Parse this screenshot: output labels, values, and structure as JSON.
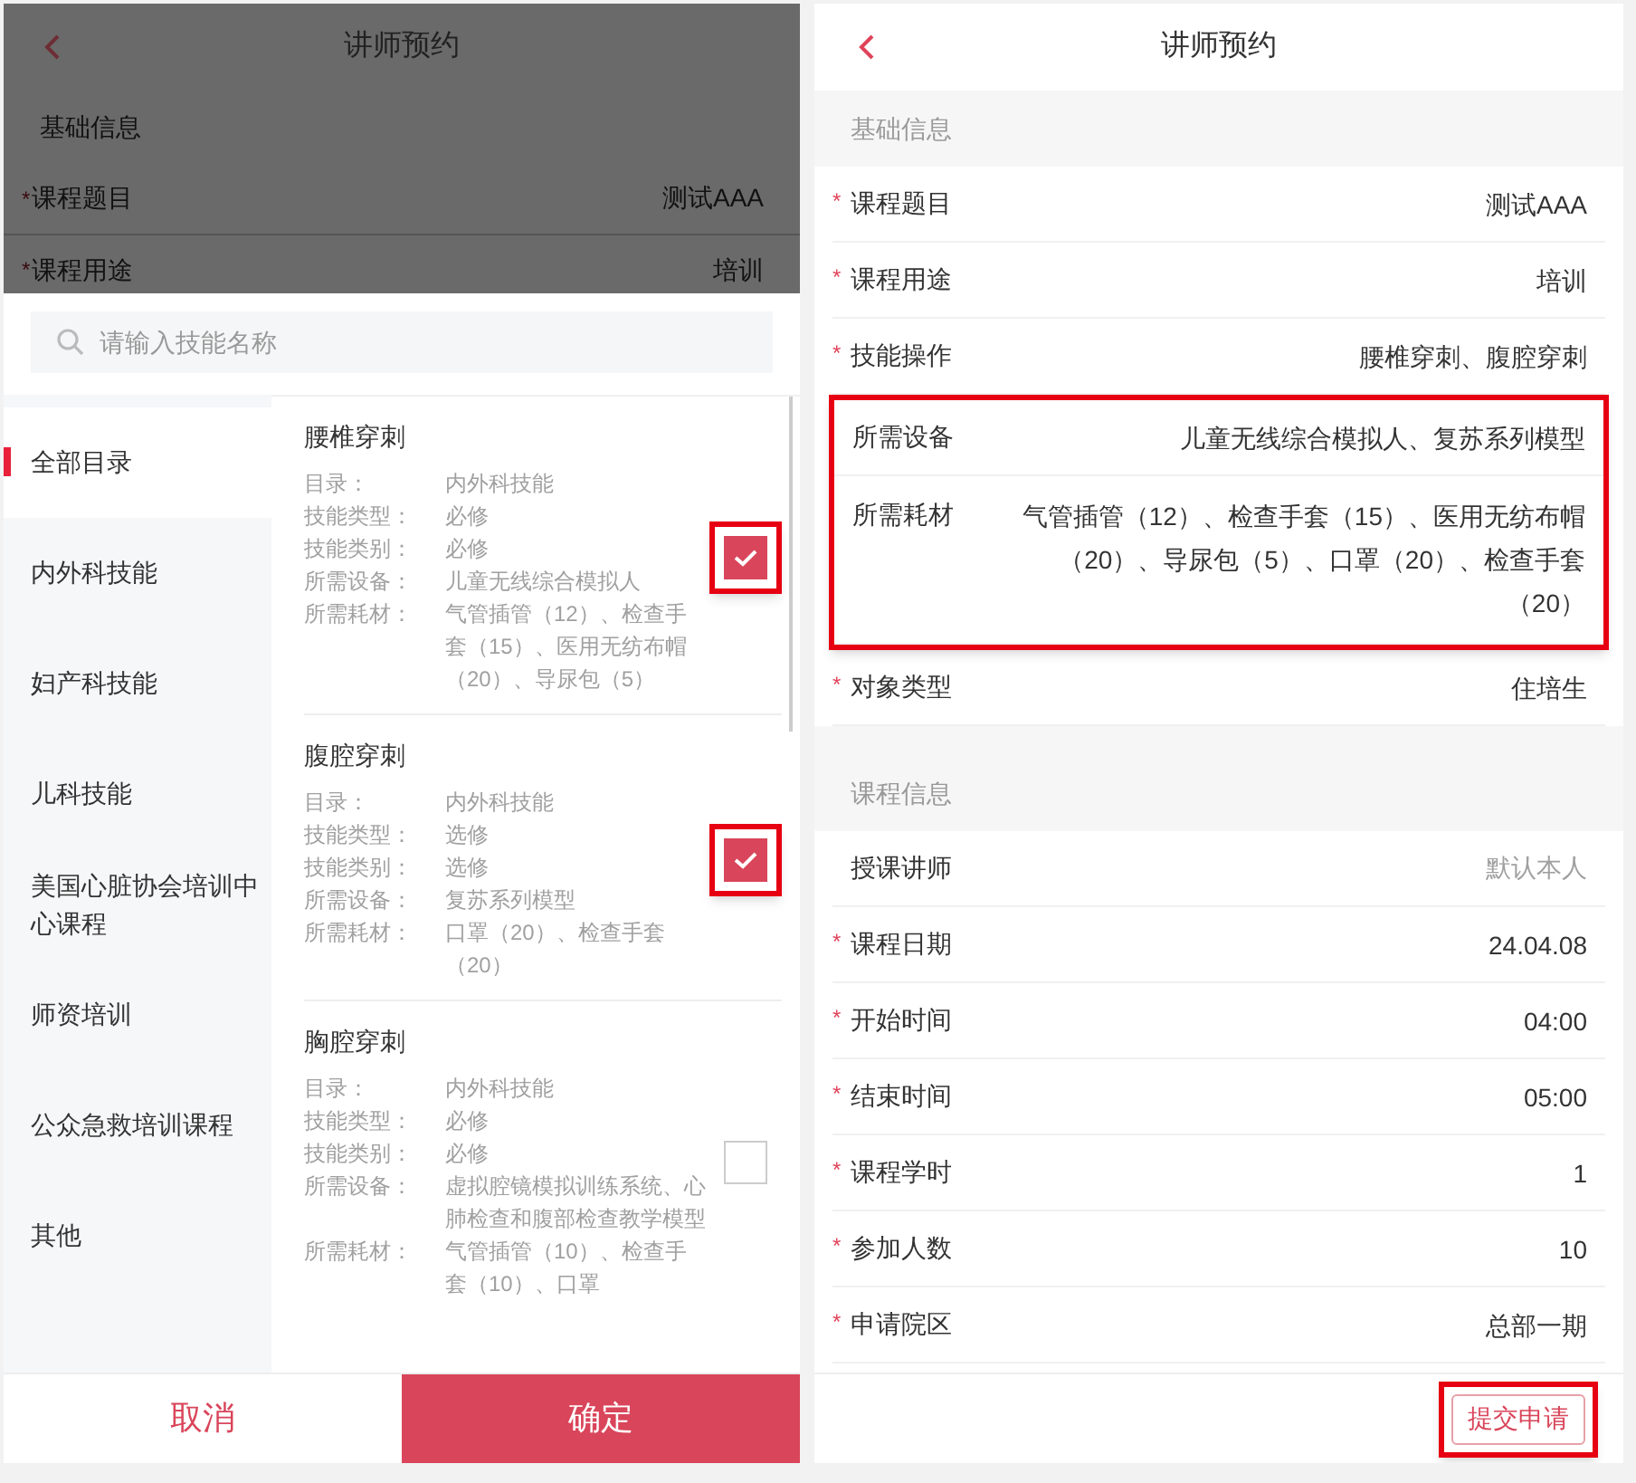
{
  "background_page": {
    "title": "讲师预约",
    "section": "基础信息",
    "rows": [
      {
        "marker": "*",
        "label": "课程题目",
        "value": "测试AAA"
      },
      {
        "marker": "*",
        "label": "课程用途",
        "value": "培训"
      }
    ]
  },
  "picker": {
    "search": {
      "placeholder": "请输入技能名称"
    },
    "categories": [
      {
        "label": "全部目录",
        "selected": true
      },
      {
        "label": "内外科技能",
        "selected": false
      },
      {
        "label": "妇产科技能",
        "selected": false
      },
      {
        "label": "儿科技能",
        "selected": false
      },
      {
        "label": "美国心脏协会培训中心课程",
        "selected": false
      },
      {
        "label": "师资培训",
        "selected": false
      },
      {
        "label": "公众急救培训课程",
        "selected": false
      },
      {
        "label": "其他",
        "selected": false
      }
    ],
    "skills": [
      {
        "name": "腰椎穿刺",
        "checked": true,
        "highlighted": true,
        "details": [
          {
            "label": "目录：",
            "value": "内外科技能"
          },
          {
            "label": "技能类型：",
            "value": "必修"
          },
          {
            "label": "技能类别：",
            "value": "必修"
          },
          {
            "label": "所需设备：",
            "value": "儿童无线综合模拟人"
          },
          {
            "label": "所需耗材：",
            "value": "气管插管（12）、检查手套（15）、医用无纺布帽（20）、导尿包（5）"
          }
        ]
      },
      {
        "name": "腹腔穿刺",
        "checked": true,
        "highlighted": true,
        "details": [
          {
            "label": "目录：",
            "value": "内外科技能"
          },
          {
            "label": "技能类型：",
            "value": "选修"
          },
          {
            "label": "技能类别：",
            "value": "选修"
          },
          {
            "label": "所需设备：",
            "value": "复苏系列模型"
          },
          {
            "label": "所需耗材：",
            "value": "口罩（20）、检查手套（20）"
          }
        ]
      },
      {
        "name": "胸腔穿刺",
        "checked": false,
        "highlighted": false,
        "details": [
          {
            "label": "目录：",
            "value": "内外科技能"
          },
          {
            "label": "技能类型：",
            "value": "必修"
          },
          {
            "label": "技能类别：",
            "value": "必修"
          },
          {
            "label": "所需设备：",
            "value": "虚拟腔镜模拟训练系统、心肺检查和腹部检查教学模型"
          },
          {
            "label": "所需耗材：",
            "value": "气管插管（10）、检查手套（10）、口罩"
          }
        ]
      }
    ],
    "cancel": "取消",
    "confirm": "确定"
  },
  "form": {
    "title": "讲师预约",
    "sections": [
      {
        "title": "基础信息",
        "rows": [
          {
            "marker": "*",
            "label": "课程题目",
            "value": "测试AAA",
            "highlighted": false
          },
          {
            "marker": "*",
            "label": "课程用途",
            "value": "培训",
            "highlighted": false
          },
          {
            "marker": "*",
            "label": "技能操作",
            "value": "腰椎穿刺、腹腔穿刺",
            "highlighted": false
          },
          {
            "label": "所需设备",
            "value": "儿童无线综合模拟人、复苏系列模型",
            "highlighted": true
          },
          {
            "label": "所需耗材",
            "value": "气管插管（12）、检查手套（15）、医用无纺布帽（20）、导尿包（5）、口罩（20）、检查手套（20）",
            "highlighted": true
          },
          {
            "marker": "*",
            "label": "对象类型",
            "value": "住培生",
            "highlighted": false
          }
        ]
      },
      {
        "title": "课程信息",
        "rows": [
          {
            "label": "授课讲师",
            "placeholder": "默认本人",
            "highlighted": false
          },
          {
            "marker": "*",
            "label": "课程日期",
            "value": "24.04.08",
            "highlighted": false
          },
          {
            "marker": "*",
            "label": "开始时间",
            "value": "04:00",
            "highlighted": false
          },
          {
            "marker": "*",
            "label": "结束时间",
            "value": "05:00",
            "highlighted": false
          },
          {
            "marker": "*",
            "label": "课程学时",
            "value": "1",
            "highlighted": false
          },
          {
            "marker": "*",
            "label": "参加人数",
            "value": "10",
            "highlighted": false
          },
          {
            "marker": "*",
            "label": "申请院区",
            "value": "总部一期",
            "highlighted": false
          }
        ]
      }
    ],
    "submit": {
      "label": "提交申请",
      "highlighted": true
    }
  }
}
